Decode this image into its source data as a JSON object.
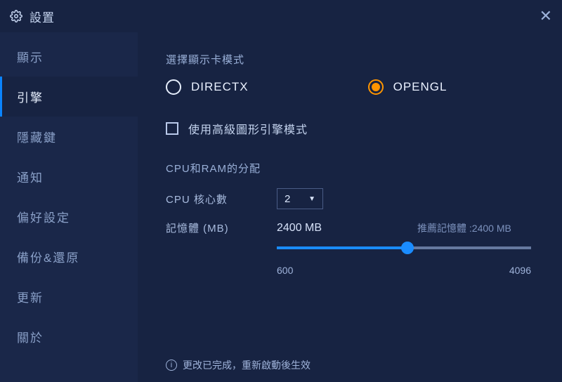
{
  "titlebar": {
    "title": "設置"
  },
  "sidebar": {
    "items": [
      {
        "label": "顯示"
      },
      {
        "label": "引擎"
      },
      {
        "label": "隱藏鍵"
      },
      {
        "label": "通知"
      },
      {
        "label": "偏好設定"
      },
      {
        "label": "備份&還原"
      },
      {
        "label": "更新"
      },
      {
        "label": "關於"
      }
    ],
    "active_index": 1
  },
  "engine": {
    "graphics_mode_label": "選擇顯示卡模式",
    "radio": {
      "directx": "DIRECTX",
      "opengl": "OPENGL",
      "selected": "opengl"
    },
    "advanced_checkbox_label": "使用高級圖形引擎模式",
    "advanced_checked": false,
    "cpu_ram_label": "CPU和RAM的分配",
    "cpu_cores_label": "CPU 核心數",
    "cpu_cores_value": "2",
    "memory_label": "記憶體 (MB)",
    "memory_value": "2400 MB",
    "memory_recommended": "推薦記憶體 :2400 MB",
    "slider": {
      "min": "600",
      "max": "4096",
      "value": 2400
    }
  },
  "footer": {
    "message": "更改已完成，重新啟動後生效"
  }
}
